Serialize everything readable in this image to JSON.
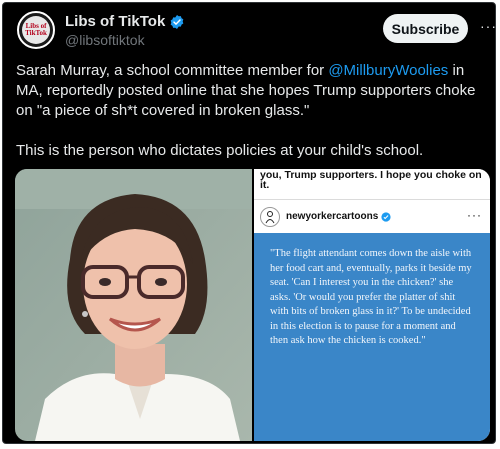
{
  "account": {
    "display_name": "Libs of TikTok",
    "handle": "@libsoftiktok",
    "avatar_text": "Libs of TikTok"
  },
  "actions": {
    "subscribe_label": "Subscribe",
    "more_label": "···"
  },
  "tweet": {
    "line1_a": "Sarah Murray, a school committee member for ",
    "mention": "@MillburyWoolies",
    "line1_b": " in MA, reportedly posted online that she hopes Trump supporters choke on \"a piece of sh*t covered in broken glass.\"",
    "line2": "This is the person who dictates policies at your child's school."
  },
  "media": {
    "screenshot_top_text": "you, Trump supporters. I hope you choke on it.",
    "ig_username": "newyorkercartoons",
    "ig_more": "···",
    "quote": "\"The flight attendant comes down the aisle with her food cart and, eventually, parks it beside my seat. 'Can I interest you in the chicken?' she asks. 'Or would you prefer the platter of shit with bits of broken glass in it?' To be undecided in this election is to pause for a moment and then ask how the chicken is cooked.\""
  },
  "colors": {
    "background": "#000000",
    "text": "#e7e9ea",
    "secondary_text": "#71767b",
    "link": "#1d9bf0",
    "verified": "#1d9bf0",
    "quote_card": "#3a86c8"
  }
}
